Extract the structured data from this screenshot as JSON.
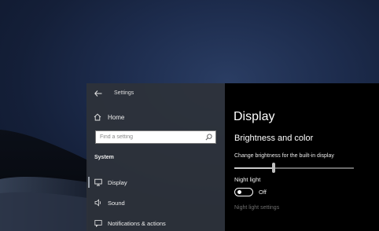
{
  "window": {
    "app_title": "Settings",
    "back_icon": "arrow-left-icon"
  },
  "nav": {
    "home": {
      "label": "Home",
      "icon": "home-icon"
    },
    "search": {
      "placeholder": "Find a setting",
      "value": "",
      "icon": "search-icon"
    },
    "section_header": "System",
    "items": [
      {
        "label": "Display",
        "icon": "monitor-icon",
        "selected": true
      },
      {
        "label": "Sound",
        "icon": "speaker-icon",
        "selected": false
      },
      {
        "label": "Notifications & actions",
        "icon": "notification-icon",
        "selected": false
      }
    ]
  },
  "content": {
    "page_title": "Display",
    "section_title": "Brightness and color",
    "brightness": {
      "label": "Change brightness for the built-in display",
      "value_fraction": 0.33
    },
    "night_light": {
      "label": "Night light",
      "state": "Off",
      "on": false,
      "settings_link": "Night light settings"
    }
  },
  "colors": {
    "nav_bg": "#2e323a",
    "content_bg": "#000000",
    "link_disabled": "#6e6e6e",
    "selection_bar": "#9aa1ab"
  }
}
